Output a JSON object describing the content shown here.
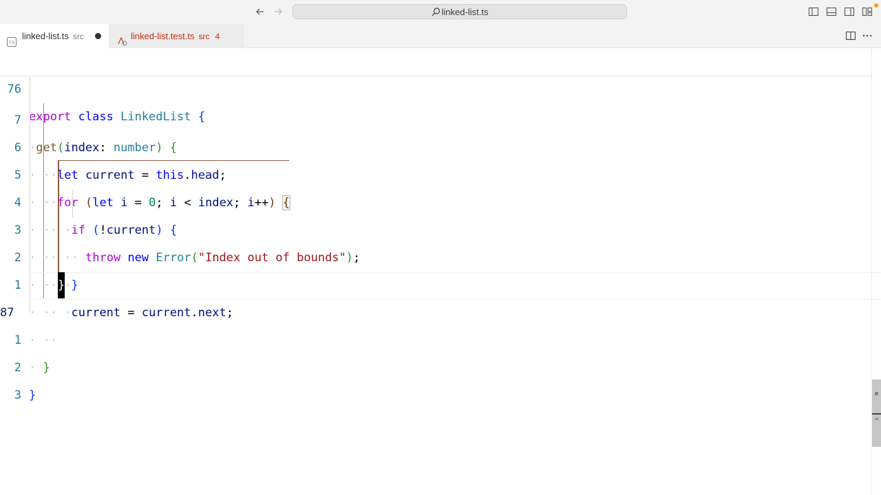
{
  "window": {
    "search_text": "linked-list.ts"
  },
  "tabs": [
    {
      "label": "linked-list.ts",
      "description": "src",
      "state": "dirty",
      "icon": "typescript-file-icon"
    },
    {
      "label": "linked-list.test.ts",
      "description": "src",
      "problems": "4",
      "icon": "test-file-icon"
    }
  ],
  "editor": {
    "sticky_line": {
      "number": "76",
      "text": "export class LinkedList {"
    },
    "current_line_number": "87",
    "line_numbers": [
      "7",
      "6",
      "5",
      "4",
      "3",
      "2",
      "1",
      "87",
      "1",
      "2",
      "3"
    ],
    "lines": {
      "l1": {
        "name": "get",
        "param": "index",
        "type": "number"
      },
      "l2": {
        "kw": "let",
        "var": "current",
        "obj": "this",
        "prop": "head"
      },
      "l3": {
        "kw": "for",
        "decl": "let",
        "i": "i",
        "num": "0",
        "idx": "index"
      },
      "l4": {
        "kw": "if",
        "var": "current"
      },
      "l5": {
        "kw": "throw",
        "new": "new",
        "type": "Error",
        "str": "\"Index out of bounds\""
      },
      "l7": {
        "var": "current",
        "prop": "next"
      }
    },
    "sticky_tokens": {
      "kw1": "export",
      "kw2": "class",
      "type": "LinkedList"
    }
  },
  "colors": {
    "keyword": "#af00db",
    "declaration": "#0000ff",
    "type": "#267f99",
    "function": "#795e26",
    "variable": "#001080",
    "number": "#098658",
    "string": "#a31515",
    "line_number": "#237893",
    "problems_tab": "#c72e0f"
  }
}
